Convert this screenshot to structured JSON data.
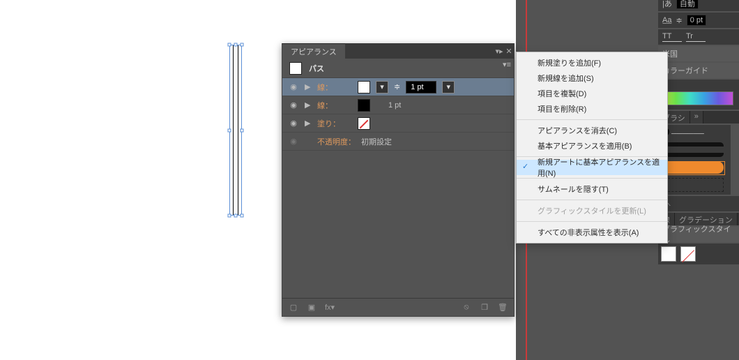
{
  "canvas": {},
  "appearance": {
    "panel_name": "アピアランス",
    "header_label": "パス",
    "rows": [
      {
        "label": "線：",
        "swatch": "white",
        "value": "1 pt"
      },
      {
        "label": "線：",
        "swatch": "black",
        "value": "1 pt"
      },
      {
        "label": "塗り：",
        "swatch": "none",
        "value": ""
      },
      {
        "label": "不透明度：",
        "swatch": "",
        "value": "初期設定"
      }
    ]
  },
  "flyout": {
    "items": [
      {
        "label": "新規塗りを追加(F)"
      },
      {
        "label": "新規線を追加(S)"
      },
      {
        "label": "項目を複製(D)"
      },
      {
        "label": "項目を削除(R)"
      }
    ],
    "items2": [
      {
        "label": "アピアランスを消去(C)"
      },
      {
        "label": "基本アピアランスを適用(B)"
      }
    ],
    "items3": [
      {
        "label": "新規アートに基本アピアランスを適用(N)",
        "checked": true
      }
    ],
    "items4": [
      {
        "label": "サムネールを隠す(T)"
      }
    ],
    "items5": [
      {
        "label": "グラフィックスタイルを更新(L)",
        "disabled": true
      }
    ],
    "items6": [
      {
        "label": "すべての非表示属性を表示(A)"
      }
    ]
  },
  "right": {
    "auto_label": "自動",
    "pt_value": "0 pt",
    "lang_label": "米国",
    "color_guide_label": "カラーガイド",
    "brush_tab": "ブラシ",
    "stroke_tab": "線",
    "grad_tab": "グラデーション",
    "gs_label": "グラフィックスタイル"
  },
  "icons": {
    "eye": "◉",
    "tri": "▶",
    "menu": "≡",
    "close": "✕",
    "min": "▾▸",
    "fx": "fx▾",
    "trash": "🗑",
    "new": "◫",
    "dup": "❐",
    "ban": "⦸",
    "char_T": "TT",
    "char_T2": "Tr",
    "check": "✓",
    "vdots": "⁝",
    "caret": "▾"
  }
}
